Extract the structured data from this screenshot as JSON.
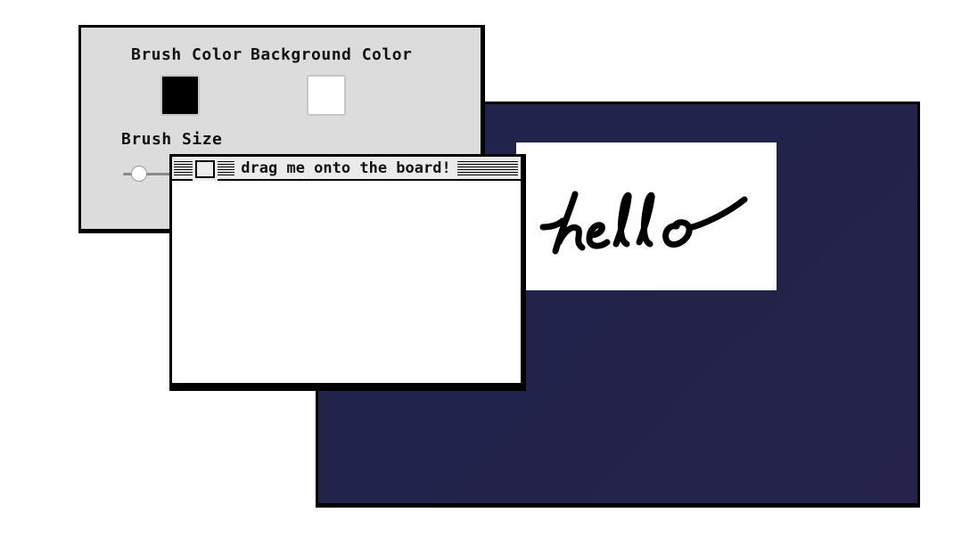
{
  "settings": {
    "brush_color_label": "Brush Color",
    "background_color_label": "Background Color",
    "brush_size_label": "Brush Size",
    "brush_color": "#000000",
    "background_color": "#ffffff",
    "brush_size_fraction": 0.3
  },
  "window": {
    "title": "drag me onto the board!"
  },
  "board": {
    "background_color": "#22234b",
    "pasted_drawing_text": "hello"
  }
}
